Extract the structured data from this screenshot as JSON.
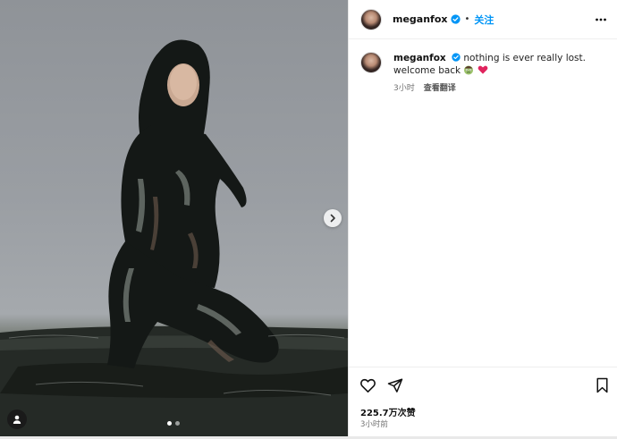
{
  "post": {
    "username": "meganfox",
    "follow_label": "关注",
    "separator": "•",
    "caption_text": "nothing is ever really lost. welcome back",
    "caption_time": "3小时",
    "see_translation": "查看翻译",
    "likes": "225.7万次赞",
    "posted_ago": "3小时前"
  },
  "carousel": {
    "current_index": 1,
    "total": 2
  },
  "icons": {
    "verified": "verified-badge-icon",
    "more": "more-options-icon",
    "like": "heart-icon",
    "share": "send-icon",
    "save": "bookmark-icon",
    "next": "chevron-right-icon",
    "tags": "user-tag-icon",
    "emoji_1": "zombie-emoji",
    "emoji_2": "red-heart-emoji"
  },
  "colors": {
    "accent": "#0095f6",
    "verified": "#0095f6",
    "heart": "#e0245e"
  }
}
